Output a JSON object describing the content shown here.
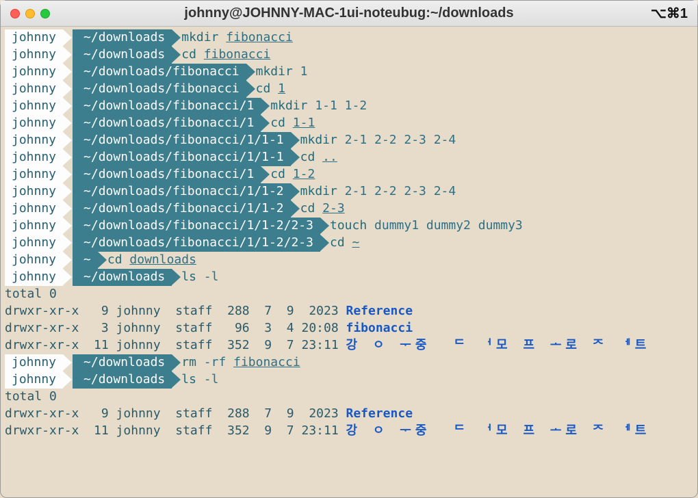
{
  "window": {
    "title": "johnny@JOHNNY-MAC-1ui-noteubug:~/downloads",
    "right_indicator": "⌥⌘1"
  },
  "prompt_user": "johnny",
  "lines": [
    {
      "path": "~/downloads",
      "cmd": "mkdir ",
      "arg": "fibonacci",
      "arg_ul": true
    },
    {
      "path": "~/downloads",
      "cmd": "cd ",
      "arg": "fibonacci",
      "arg_ul": true
    },
    {
      "path": "~/downloads/fibonacci",
      "cmd": "mkdir ",
      "arg": "1"
    },
    {
      "path": "~/downloads/fibonacci",
      "cmd": "cd ",
      "arg": "1",
      "arg_ul": true
    },
    {
      "path": "~/downloads/fibonacci/1",
      "cmd": "mkdir ",
      "arg": "1-1 1-2"
    },
    {
      "path": "~/downloads/fibonacci/1",
      "cmd": "cd ",
      "arg": "1-1",
      "arg_ul": true
    },
    {
      "path": "~/downloads/fibonacci/1/1-1",
      "cmd": "mkdir ",
      "arg": "2-1 2-2 2-3 2-4"
    },
    {
      "path": "~/downloads/fibonacci/1/1-1",
      "cmd": "cd ",
      "arg": "..",
      "arg_ul": true
    },
    {
      "path": "~/downloads/fibonacci/1",
      "cmd": "cd ",
      "arg": "1-2",
      "arg_ul": true
    },
    {
      "path": "~/downloads/fibonacci/1/1-2",
      "cmd": "mkdir ",
      "arg": "2-1 2-2 2-3 2-4"
    },
    {
      "path": "~/downloads/fibonacci/1/1-2",
      "cmd": "cd ",
      "arg": "2-3",
      "arg_ul": true
    },
    {
      "path": "~/downloads/fibonacci/1/1-2/2-3",
      "cmd": "touch ",
      "arg": "dummy1 dummy2 dummy3"
    },
    {
      "path": "~/downloads/fibonacci/1/1-2/2-3",
      "cmd": "cd ",
      "arg": "~",
      "arg_ul": true
    },
    {
      "path": "~",
      "cmd": "cd ",
      "arg": "downloads",
      "arg_ul": true
    },
    {
      "path": "~/downloads",
      "cmd": "ls ",
      "arg": "-l"
    }
  ],
  "ls1_header": "total 0",
  "ls1": [
    {
      "perm": "drwxr-xr-x",
      "n": "9",
      "owner": "johnny",
      "group": "staff",
      "size": "288",
      "date": "7  9  2023",
      "name": "Reference",
      "han": false
    },
    {
      "perm": "drwxr-xr-x",
      "n": "3",
      "owner": "johnny",
      "group": "staff",
      "size": "96",
      "date": "3  4 20:08",
      "name": "fibonacci",
      "han": false
    },
    {
      "perm": "drwxr-xr-x",
      "n": "11",
      "owner": "johnny",
      "group": "staff",
      "size": "352",
      "date": "9  7 23:11",
      "name": "강 ㅇ ᅮ중  ᄃ ᅥ모 프 ᅩ로 ᄌ ᅦ트",
      "han": true
    }
  ],
  "lines2": [
    {
      "path": "~/downloads",
      "cmd": "rm ",
      "arg": "-rf ",
      "arg2": "fibonacci",
      "arg2_ul": true
    },
    {
      "path": "~/downloads",
      "cmd": "ls ",
      "arg": "-l"
    }
  ],
  "ls2_header": "total 0",
  "ls2": [
    {
      "perm": "drwxr-xr-x",
      "n": "9",
      "owner": "johnny",
      "group": "staff",
      "size": "288",
      "date": "7  9  2023",
      "name": "Reference",
      "han": false
    },
    {
      "perm": "drwxr-xr-x",
      "n": "11",
      "owner": "johnny",
      "group": "staff",
      "size": "352",
      "date": "9  7 23:11",
      "name": "강 ㅇ ᅮ중  ᄃ ᅥ모 프 ᅩ로 ᄌ ᅦ트",
      "han": true
    }
  ]
}
